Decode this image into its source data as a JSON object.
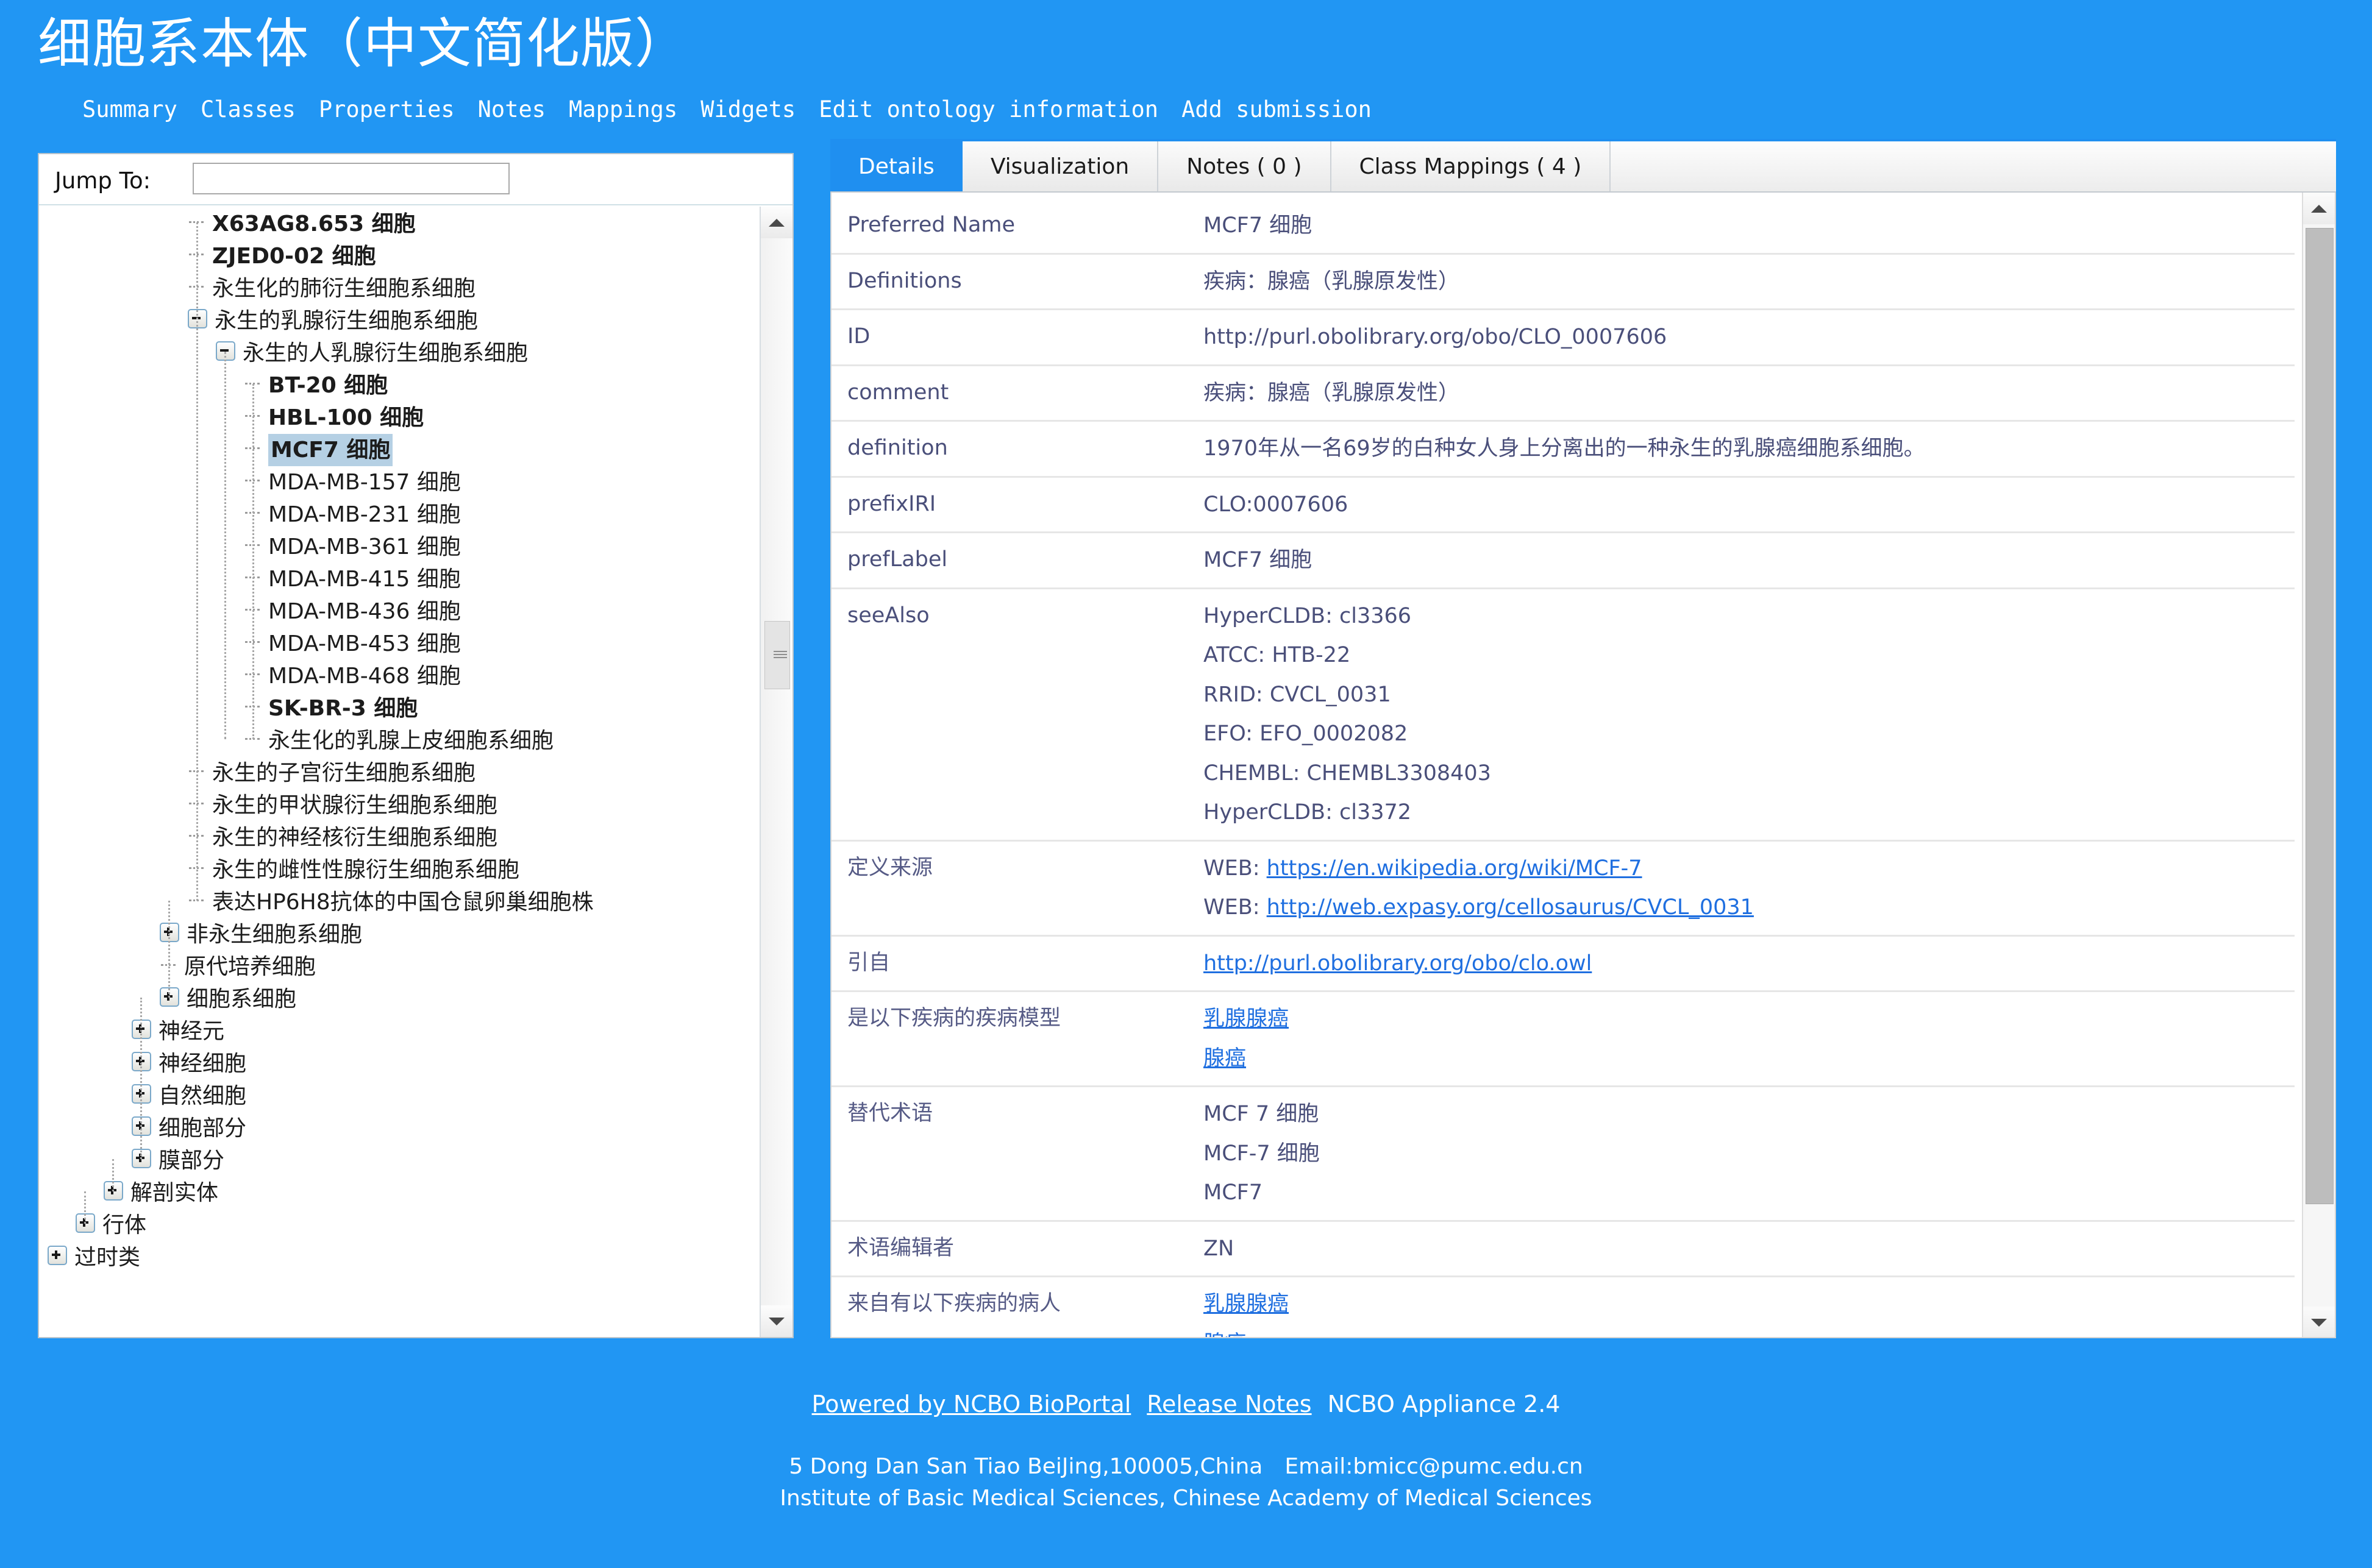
{
  "header": {
    "title": "细胞系本体（中文简化版）",
    "nav": [
      "Summary",
      "Classes",
      "Properties",
      "Notes",
      "Mappings",
      "Widgets",
      "Edit ontology information",
      "Add submission"
    ]
  },
  "tree": {
    "jump_label": "Jump To:",
    "jump_value": "",
    "jump_placeholder": "",
    "nodes": [
      {
        "label": "X63AG8.653 细胞",
        "indent": 4,
        "toggle": "none",
        "bold": true,
        "selected": false
      },
      {
        "label": "ZJED0-02 细胞",
        "indent": 4,
        "toggle": "none",
        "bold": true,
        "selected": false
      },
      {
        "label": "永生化的肺衍生细胞系细胞",
        "indent": 4,
        "toggle": "none",
        "bold": false,
        "selected": false
      },
      {
        "label": "永生的乳腺衍生细胞系细胞",
        "indent": 4,
        "toggle": "minus",
        "bold": false,
        "selected": false
      },
      {
        "label": "永生的人乳腺衍生细胞系细胞",
        "indent": 5,
        "toggle": "minus",
        "bold": false,
        "selected": false
      },
      {
        "label": "BT-20 细胞",
        "indent": 6,
        "toggle": "none",
        "bold": true,
        "selected": false
      },
      {
        "label": "HBL-100 细胞",
        "indent": 6,
        "toggle": "none",
        "bold": true,
        "selected": false
      },
      {
        "label": "MCF7 细胞",
        "indent": 6,
        "toggle": "none",
        "bold": true,
        "selected": true
      },
      {
        "label": "MDA-MB-157 细胞",
        "indent": 6,
        "toggle": "none",
        "bold": false,
        "selected": false
      },
      {
        "label": "MDA-MB-231 细胞",
        "indent": 6,
        "toggle": "none",
        "bold": false,
        "selected": false
      },
      {
        "label": "MDA-MB-361 细胞",
        "indent": 6,
        "toggle": "none",
        "bold": false,
        "selected": false
      },
      {
        "label": "MDA-MB-415 细胞",
        "indent": 6,
        "toggle": "none",
        "bold": false,
        "selected": false
      },
      {
        "label": "MDA-MB-436 细胞",
        "indent": 6,
        "toggle": "none",
        "bold": false,
        "selected": false
      },
      {
        "label": "MDA-MB-453 细胞",
        "indent": 6,
        "toggle": "none",
        "bold": false,
        "selected": false
      },
      {
        "label": "MDA-MB-468 细胞",
        "indent": 6,
        "toggle": "none",
        "bold": false,
        "selected": false
      },
      {
        "label": "SK-BR-3 细胞",
        "indent": 6,
        "toggle": "none",
        "bold": true,
        "selected": false
      },
      {
        "label": "永生化的乳腺上皮细胞系细胞",
        "indent": 6,
        "toggle": "none",
        "bold": false,
        "selected": false
      },
      {
        "label": "永生的子宫衍生细胞系细胞",
        "indent": 4,
        "toggle": "none",
        "bold": false,
        "selected": false
      },
      {
        "label": "永生的甲状腺衍生细胞系细胞",
        "indent": 4,
        "toggle": "none",
        "bold": false,
        "selected": false
      },
      {
        "label": "永生的神经核衍生细胞系细胞",
        "indent": 4,
        "toggle": "none",
        "bold": false,
        "selected": false
      },
      {
        "label": "永生的雌性性腺衍生细胞系细胞",
        "indent": 4,
        "toggle": "none",
        "bold": false,
        "selected": false
      },
      {
        "label": "表达HP6H8抗体的中国仓鼠卵巢细胞株",
        "indent": 4,
        "toggle": "none",
        "bold": false,
        "selected": false
      },
      {
        "label": "非永生细胞系细胞",
        "indent": 3,
        "toggle": "plus",
        "bold": false,
        "selected": false
      },
      {
        "label": "原代培养细胞",
        "indent": 3,
        "toggle": "none",
        "bold": false,
        "selected": false
      },
      {
        "label": "细胞系细胞",
        "indent": 3,
        "toggle": "plus",
        "bold": false,
        "selected": false
      },
      {
        "label": "神经元",
        "indent": 2,
        "toggle": "plus",
        "bold": false,
        "selected": false
      },
      {
        "label": "神经细胞",
        "indent": 2,
        "toggle": "plus",
        "bold": false,
        "selected": false
      },
      {
        "label": "自然细胞",
        "indent": 2,
        "toggle": "plus",
        "bold": false,
        "selected": false
      },
      {
        "label": "细胞部分",
        "indent": 2,
        "toggle": "plus",
        "bold": false,
        "selected": false
      },
      {
        "label": "膜部分",
        "indent": 2,
        "toggle": "plus",
        "bold": false,
        "selected": false
      },
      {
        "label": "解剖实体",
        "indent": 1,
        "toggle": "plus",
        "bold": false,
        "selected": false
      },
      {
        "label": "行体",
        "indent": 0,
        "toggle": "plus",
        "bold": false,
        "selected": false
      },
      {
        "label": "过时类",
        "indent": -1,
        "toggle": "plus",
        "bold": false,
        "selected": false
      }
    ]
  },
  "details": {
    "tabs": [
      {
        "label": "Details",
        "active": true
      },
      {
        "label": "Visualization",
        "active": false
      },
      {
        "label": "Notes ( 0 )",
        "active": false
      },
      {
        "label": "Class Mappings ( 4 )",
        "active": false
      }
    ],
    "rows": [
      {
        "key": "Preferred Name",
        "values": [
          {
            "text": "MCF7 细胞",
            "link": false
          }
        ]
      },
      {
        "key": "Definitions",
        "values": [
          {
            "text": "疾病：腺癌（乳腺原发性）",
            "link": false
          }
        ]
      },
      {
        "key": "ID",
        "values": [
          {
            "text": "http://purl.obolibrary.org/obo/CLO_0007606",
            "link": false
          }
        ]
      },
      {
        "key": "comment",
        "values": [
          {
            "text": "疾病：腺癌（乳腺原发性）",
            "link": false
          }
        ]
      },
      {
        "key": "definition",
        "values": [
          {
            "text": "1970年从一名69岁的白种女人身上分离出的一种永生的乳腺癌细胞系细胞。",
            "link": false
          }
        ]
      },
      {
        "key": "prefixIRI",
        "values": [
          {
            "text": "CLO:0007606",
            "link": false
          }
        ]
      },
      {
        "key": "prefLabel",
        "values": [
          {
            "text": "MCF7 细胞",
            "link": false
          }
        ]
      },
      {
        "key": "seeAlso",
        "values": [
          {
            "text": "HyperCLDB: cl3366",
            "link": false
          },
          {
            "text": "ATCC: HTB-22",
            "link": false
          },
          {
            "text": "RRID: CVCL_0031",
            "link": false
          },
          {
            "text": "EFO: EFO_0002082",
            "link": false
          },
          {
            "text": "CHEMBL: CHEMBL3308403",
            "link": false
          },
          {
            "text": "HyperCLDB: cl3372",
            "link": false
          }
        ]
      },
      {
        "key": "定义来源",
        "values": [
          {
            "prefix": "WEB: ",
            "text": "https://en.wikipedia.org/wiki/MCF-7",
            "link": true
          },
          {
            "prefix": "WEB: ",
            "text": "http://web.expasy.org/cellosaurus/CVCL_0031",
            "link": true
          }
        ]
      },
      {
        "key": "引自",
        "values": [
          {
            "text": "http://purl.obolibrary.org/obo/clo.owl",
            "link": true
          }
        ]
      },
      {
        "key": "是以下疾病的疾病模型",
        "values": [
          {
            "text": "乳腺腺癌",
            "link": true
          },
          {
            "text": "腺癌",
            "link": true
          }
        ]
      },
      {
        "key": "替代术语",
        "values": [
          {
            "text": "MCF 7 细胞",
            "link": false
          },
          {
            "text": "MCF-7 细胞",
            "link": false
          },
          {
            "text": "MCF7",
            "link": false
          }
        ]
      },
      {
        "key": "术语编辑者",
        "values": [
          {
            "text": "ZN",
            "link": false
          }
        ]
      },
      {
        "key": "来自有以下疾病的病人",
        "values": [
          {
            "text": "乳腺腺癌",
            "link": true
          },
          {
            "text": "腺癌",
            "link": true
          }
        ]
      }
    ]
  },
  "footer": {
    "powered_by": "Powered by NCBO BioPortal",
    "release_notes": "Release Notes",
    "appliance": "NCBO Appliance 2.4",
    "address": "5 Dong Dan San Tiao BeiJing,100005,China",
    "email": "Email:bmicc@pumc.edu.cn",
    "institute": "Institute of Basic Medical Sciences, Chinese Academy of Medical Sciences"
  },
  "colors": {
    "brand_blue": "#2196f3",
    "tab_active": "#1f8ff0",
    "selection": "#b5d0e4",
    "link": "#1f6fe0",
    "value_text": "#4a4f7a"
  }
}
